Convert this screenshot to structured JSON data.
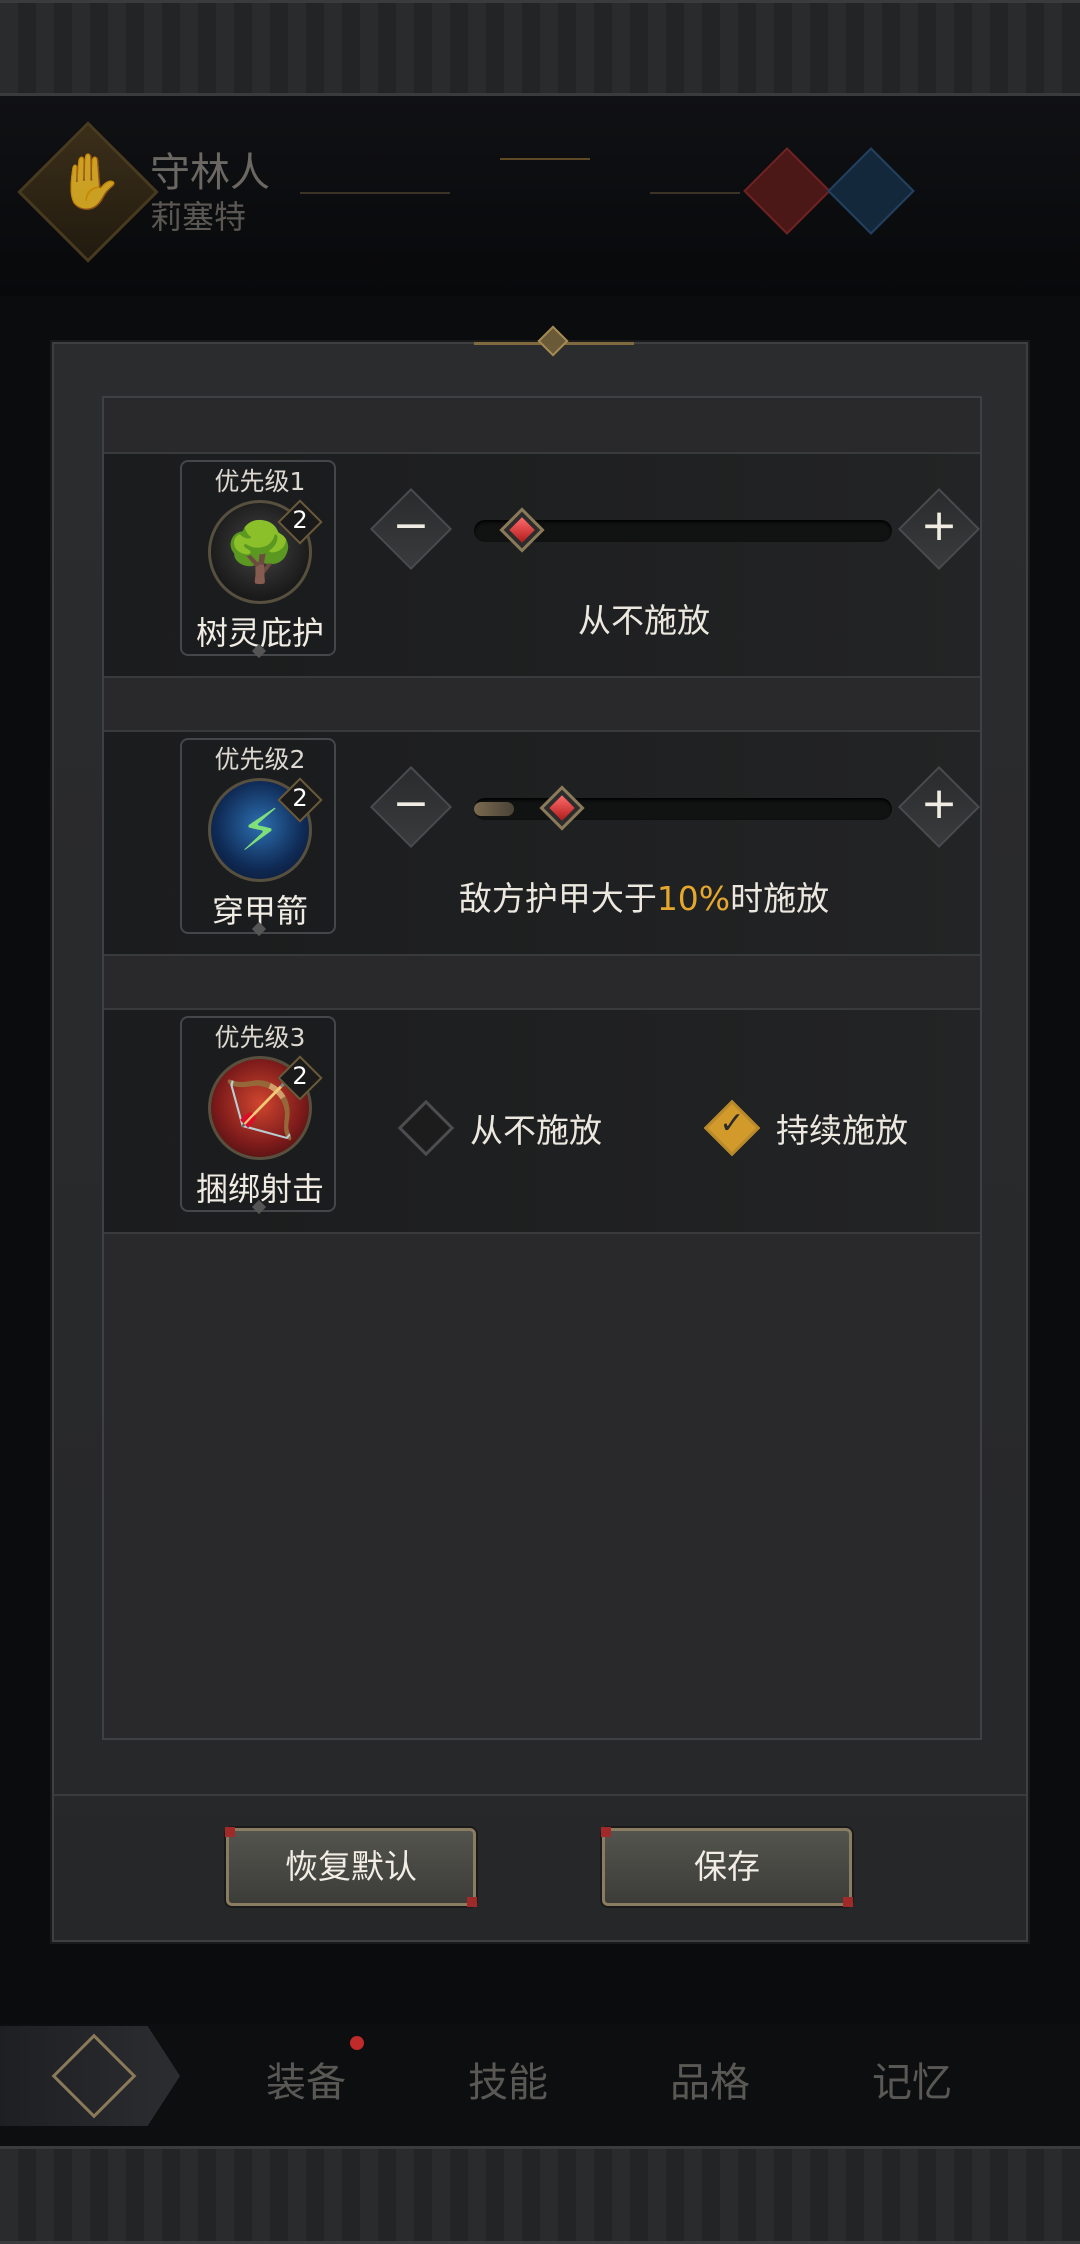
{
  "background": {
    "class_name": "守林人",
    "character_name": "莉塞特"
  },
  "dialog": {
    "rows": [
      {
        "priority": "优先级1",
        "skill_name": "树灵庇护",
        "level": "2",
        "icon": "tree-spirit-icon",
        "control": "slider",
        "slider_value": 0,
        "caption": "从不施放"
      },
      {
        "priority": "优先级2",
        "skill_name": "穿甲箭",
        "level": "2",
        "icon": "piercing-arrow-icon",
        "control": "slider",
        "slider_value": 10,
        "caption_prefix": "敌方护甲大于",
        "caption_value": "10%",
        "caption_suffix": "时施放"
      },
      {
        "priority": "优先级3",
        "skill_name": "捆绑射击",
        "level": "2",
        "icon": "binding-shot-icon",
        "control": "radio",
        "options": [
          {
            "label": "从不施放",
            "selected": false
          },
          {
            "label": "持续施放",
            "selected": true
          }
        ]
      }
    ],
    "buttons": {
      "reset": "恢复默认",
      "save": "保存"
    },
    "minus_glyph": "−",
    "plus_glyph": "+"
  },
  "bottom_nav": {
    "items": [
      "装备",
      "技能",
      "品格",
      "记忆"
    ],
    "badge_on": "装备"
  },
  "colors": {
    "accent_gold": "#e6a82c",
    "thumb_red": "#b01c1c",
    "badge_red": "#c02a2a"
  }
}
